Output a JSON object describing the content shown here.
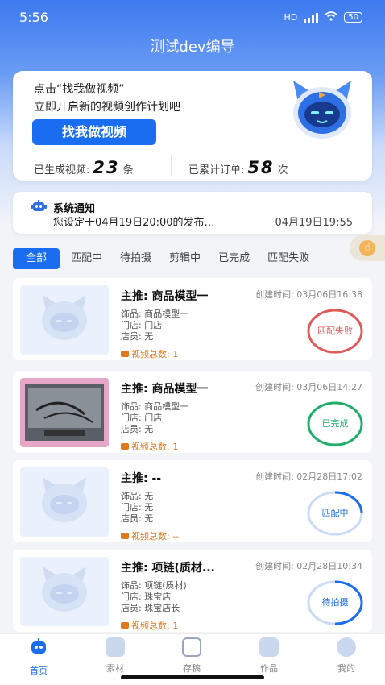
{
  "status_bar": {
    "time": "5:56",
    "network": "HD",
    "battery": "50"
  },
  "app_title": "测试dev编导",
  "hero": {
    "line1": "点击“找我做视频”",
    "line2": "立即开启新的视频创作计划吧",
    "button": "找我做视频",
    "generated_label": "已生成视频:",
    "generated_value": "23",
    "generated_unit": "条",
    "orders_label": "已累计订单:",
    "orders_value": "58",
    "orders_unit": "次",
    "mascot_icon": "robot-cat-mascot-icon"
  },
  "notice": {
    "icon": "robot-icon",
    "title": "系统通知",
    "text": "您设定于04月19日20:00的发布…",
    "time": "04月19日19:55"
  },
  "tabs": [
    "全部",
    "匹配中",
    "待拍摄",
    "剪辑中",
    "已完成",
    "匹配失败"
  ],
  "tab_active_index": 0,
  "colors": {
    "accent": "#1a6df0",
    "failed": "#e05a5a",
    "done": "#1fae6a",
    "progress": "#1a6df0",
    "count": "#e07a1f"
  },
  "cards": [
    {
      "title": "主推:  商品模型一",
      "created": "创建时间: 03月06日16:38",
      "item": "饰品: 商品模型一",
      "store": "门店: 门店",
      "staff": "店员: 无",
      "count": "视频总数: 1",
      "status": "匹配失败",
      "status_color": "#e05a5a",
      "progress": 1.0,
      "thumb": "placeholder"
    },
    {
      "title": "主推:  商品模型一",
      "created": "创建时间: 03月06日14:27",
      "item": "饰品: 商品模型一",
      "store": "门店: 门店",
      "staff": "店员: 无",
      "count": "视频总数: 1",
      "status": "已完成",
      "status_color": "#1fae6a",
      "progress": 1.0,
      "thumb": "photo"
    },
    {
      "title": "主推:  --",
      "created": "创建时间: 02月28日17:02",
      "item": "饰品: 无",
      "store": "门店: 无",
      "staff": "店员: 无",
      "count": "视频总数: --",
      "status": "匹配中",
      "status_color": "#1a6df0",
      "progress": 0.25,
      "thumb": "placeholder"
    },
    {
      "title": "主推:  项链(质材...",
      "created": "创建时间: 02月28日10:34",
      "item": "饰品: 项链(质材)",
      "store": "门店: 珠宝店",
      "staff": "店员: 珠宝店长",
      "count": "视频总数: 1",
      "status": "待拍摄",
      "status_color": "#1a6df0",
      "progress": 0.5,
      "thumb": "placeholder"
    }
  ],
  "bottom_nav": [
    {
      "label": "首页",
      "icon": "home-robot-icon",
      "active": true
    },
    {
      "label": "素材",
      "icon": "material-icon",
      "active": false
    },
    {
      "label": "存稿",
      "icon": "drafts-icon",
      "active": false
    },
    {
      "label": "作品",
      "icon": "works-icon",
      "active": false
    },
    {
      "label": "我的",
      "icon": "profile-icon",
      "active": false
    }
  ]
}
